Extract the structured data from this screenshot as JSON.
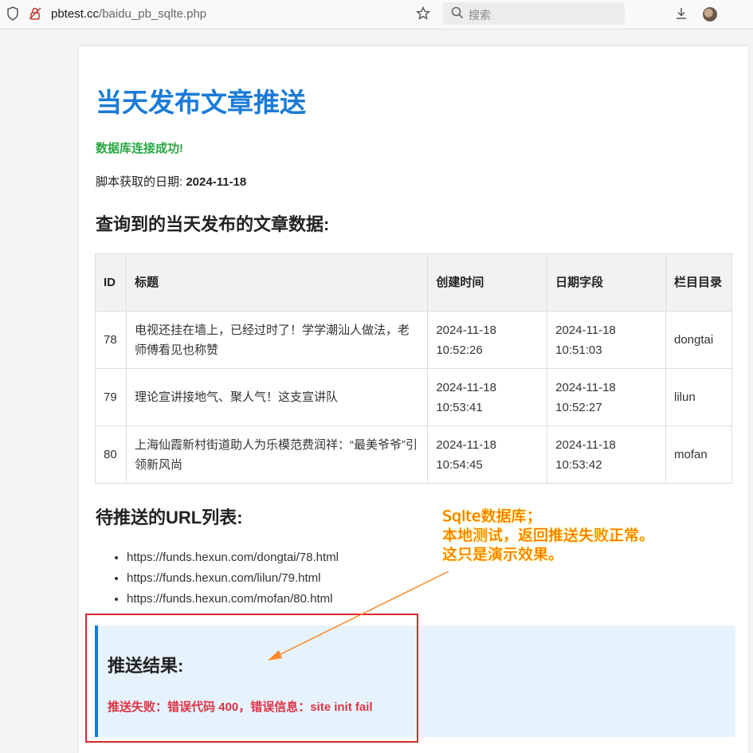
{
  "browser": {
    "url_host": "pbtest.cc",
    "url_path": "/baidu_pb_sqlte.php",
    "search_placeholder": "搜索"
  },
  "page": {
    "title": "当天发布文章推送",
    "db_status": "数据库连接成功!",
    "date_label": "脚本获取的日期: ",
    "date_value": "2024-11-18",
    "articles_heading": "查询到的当天发布的文章数据:",
    "table": {
      "headers": [
        "ID",
        "标题",
        "创建时间",
        "日期字段",
        "栏目目录"
      ],
      "rows": [
        [
          "78",
          "电视还挂在墙上，已经过时了！学学潮汕人做法，老师傅看见也称赞",
          "2024-11-18 10:52:26",
          "2024-11-18 10:51:03",
          "dongtai"
        ],
        [
          "79",
          "理论宣讲接地气、聚人气！这支宣讲队",
          "2024-11-18 10:53:41",
          "2024-11-18 10:52:27",
          "lilun"
        ],
        [
          "80",
          "上海仙霞新村街道助人为乐模范费润祥：“最美爷爷”引领新风尚",
          "2024-11-18 10:54:45",
          "2024-11-18 10:53:42",
          "mofan"
        ]
      ]
    },
    "urls_heading": "待推送的URL列表:",
    "urls": [
      "https://funds.hexun.com/dongtai/78.html",
      "https://funds.hexun.com/lilun/79.html",
      "https://funds.hexun.com/mofan/80.html"
    ],
    "result_heading": "推送结果:",
    "result_error": "推送失败：错误代码 400，错误信息：site init fail"
  },
  "annotation": {
    "lines": [
      "Sqlte数据库；",
      "本地测试，返回推送失败正常。",
      "这只是演示效果。"
    ]
  },
  "colors": {
    "title_blue": "#1a7bd8",
    "success_green": "#28a745",
    "error_red": "#dc3545",
    "annotation_orange": "#ff6a00",
    "frame_red": "#d9262b"
  }
}
